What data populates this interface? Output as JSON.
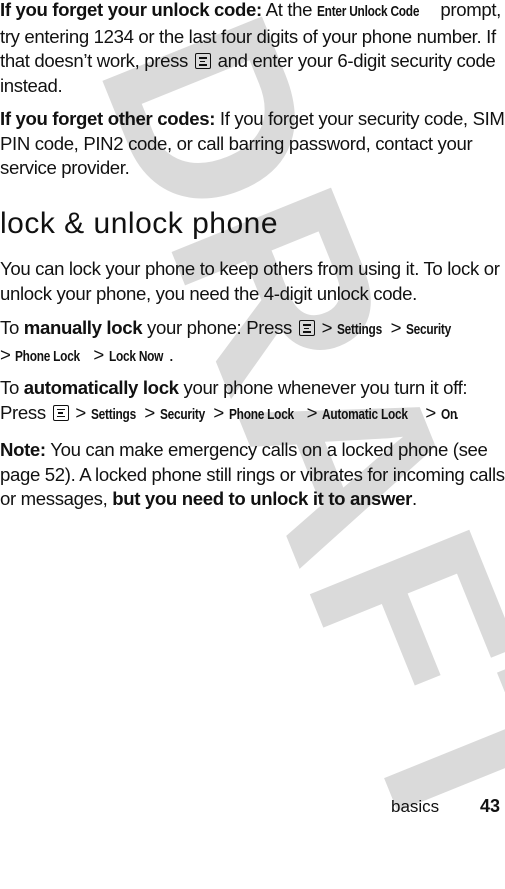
{
  "watermark": "DRAFT",
  "menu_key_icon": "menu-key-icon",
  "para1": {
    "lead": "If you forget your unlock code:",
    "t1": " At the ",
    "ui1": "Enter Unlock Code",
    "t2": " prompt, try entering 1234 or the last four digits of your phone number. If that doesn’t work, press ",
    "t3": " and enter your 6-digit security code instead."
  },
  "para2": {
    "lead": "If you forget other codes:",
    "t1": " If you forget your security code, SIM PIN code, PIN2 code, or call barring password, contact your service provider."
  },
  "heading": "lock & unlock phone",
  "para3": "You can lock your phone to keep others from using it. To lock or unlock your phone, you need the 4-digit unlock code.",
  "para4": {
    "t1": "To ",
    "bold": "manually lock",
    "t2": " your phone: Press ",
    "sep": " > ",
    "path": [
      "Settings",
      "Security",
      "Phone Lock",
      "Lock Now"
    ],
    "end": "."
  },
  "para5": {
    "t1": "To ",
    "bold": "automatically lock",
    "t2": " your phone whenever you turn it off: Press ",
    "sep": " > ",
    "path": [
      "Settings",
      "Security",
      "Phone Lock",
      "Automatic Lock",
      "On"
    ],
    "end": "."
  },
  "note": {
    "lead": "Note:",
    "t1": " You can make emergency calls on a locked phone (see page 52). A locked phone still rings or vibrates for incoming calls or messages, ",
    "bold": "but you need to unlock it to answer",
    "end": "."
  },
  "footer": {
    "section": "basics",
    "page_number": "43"
  }
}
